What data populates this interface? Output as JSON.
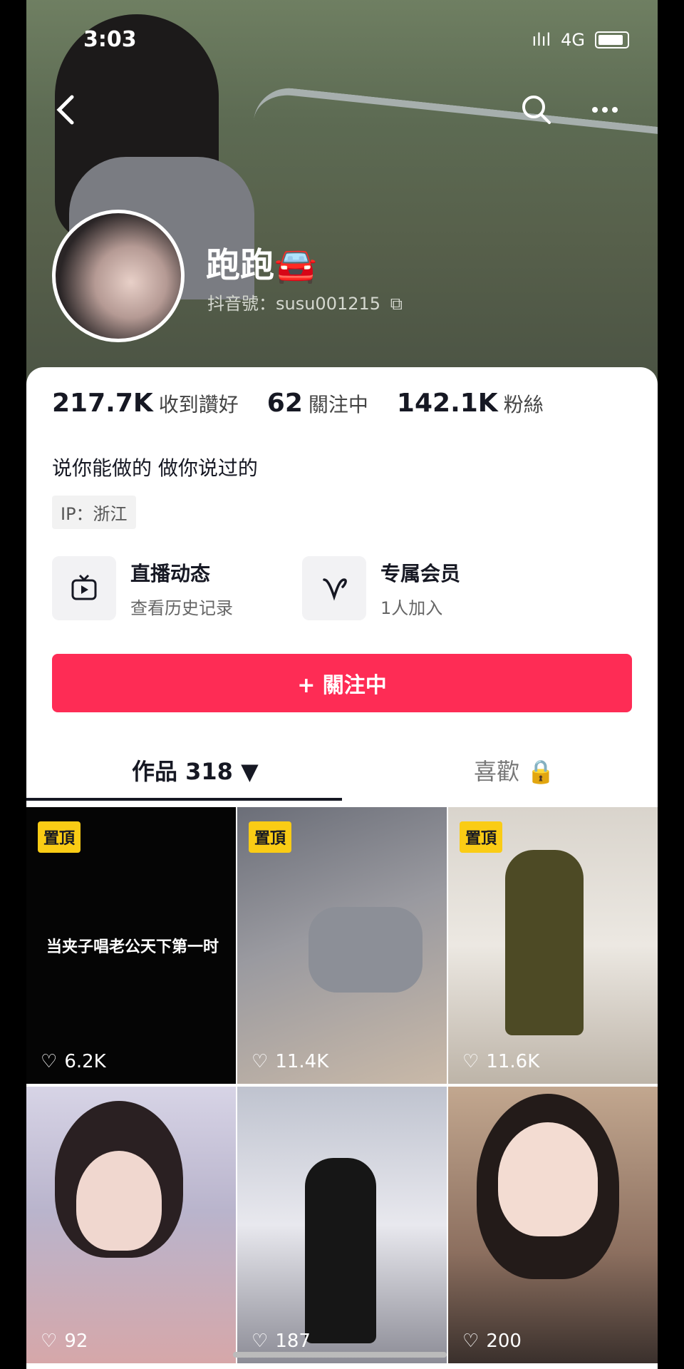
{
  "status_bar": {
    "time": "3:03",
    "network": "4G",
    "signal": "ılıl"
  },
  "header": {
    "back_icon": "chevron-left-icon",
    "search_icon": "search-icon",
    "more_icon": "more-icon"
  },
  "profile": {
    "name": "跑跑🚘",
    "handle": "抖音號：susu001215",
    "copy_icon": "copy-icon"
  },
  "stats": [
    {
      "value": "217.7K",
      "label": "收到讚好"
    },
    {
      "value": "62",
      "label": "關注中"
    },
    {
      "value": "142.1K",
      "label": "粉絲"
    }
  ],
  "bio": "说你能做的 做你说过的",
  "ip": "IP：浙江",
  "features": [
    {
      "title": "直播动态",
      "subtitle": "查看历史记录",
      "icon": "tv-icon"
    },
    {
      "title": "专属会员",
      "subtitle": "1人加入",
      "icon": "v-heart-icon"
    }
  ],
  "follow_button": "+ 關注中",
  "tabs": [
    {
      "label": "作品 318 ▼",
      "active": true
    },
    {
      "label": "喜歡 🔒",
      "active": false
    }
  ],
  "videos": [
    {
      "pinned": "置頂",
      "likes": "6.2K",
      "overlay": "当夹子唱老公天下第一时"
    },
    {
      "pinned": "置頂",
      "likes": "11.4K",
      "overlay": ""
    },
    {
      "pinned": "置頂",
      "likes": "11.6K",
      "overlay": ""
    },
    {
      "pinned": "",
      "likes": "92",
      "overlay": ""
    },
    {
      "pinned": "",
      "likes": "187",
      "overlay": ""
    },
    {
      "pinned": "",
      "likes": "200",
      "overlay": ""
    }
  ],
  "colors": {
    "accent": "#fe2c55",
    "pin": "#facc15"
  }
}
